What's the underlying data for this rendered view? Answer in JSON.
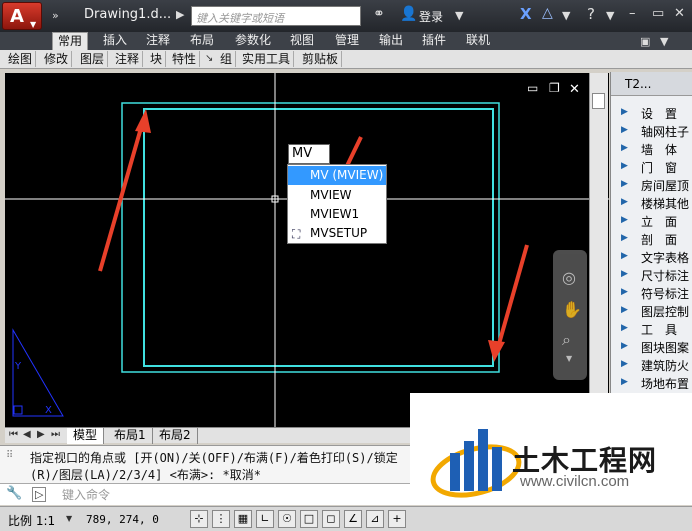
{
  "titlebar": {
    "doc_title": "Drawing1.d...",
    "search_placeholder": "键入关键字或短语",
    "login": "登录",
    "app_letter": "A"
  },
  "ribbon": {
    "tabs": [
      "常用",
      "插入",
      "注释",
      "布局",
      "参数化",
      "视图",
      "管理",
      "输出",
      "插件",
      "联机"
    ],
    "active_tab": "常用"
  },
  "panels": [
    "绘图",
    "修改",
    "图层",
    "注释",
    "块",
    "特性",
    "组",
    "实用工具",
    "剪贴板"
  ],
  "autocomplete": {
    "typed": "MV",
    "items": [
      "MV (MVIEW)",
      "MVIEW",
      "MVIEW1",
      "MVSETUP"
    ],
    "selected_index": 0
  },
  "palette": {
    "header": "T2...",
    "items": [
      "设　置",
      "轴网柱子",
      "墙　体",
      "门　窗",
      "房间屋顶",
      "楼梯其他",
      "立　面",
      "剖　面",
      "文字表格",
      "尺寸标注",
      "符号标注",
      "图层控制",
      "工　具",
      "图块图案",
      "建筑防火",
      "场地布置"
    ]
  },
  "layout_tabs": [
    "模型",
    "布局1",
    "布局2"
  ],
  "layout_active": "模型",
  "command": {
    "line1": "指定视口的角点或 [开(ON)/关(OFF)/布满(F)/着色打印(S)/锁定",
    "line2": "(R)/图层(LA)/2/3/4] <布满>: *取消*",
    "input_placeholder": "键入命令"
  },
  "status": {
    "scale": "比例 1:1",
    "coords": "789, 274, 0"
  },
  "watermark": {
    "title": "土木工程网",
    "url": "www.civilcn.com"
  },
  "colors": {
    "viewport_border": "#40e0e0",
    "arrow": "#e8402a",
    "selection": "#3399ff"
  }
}
